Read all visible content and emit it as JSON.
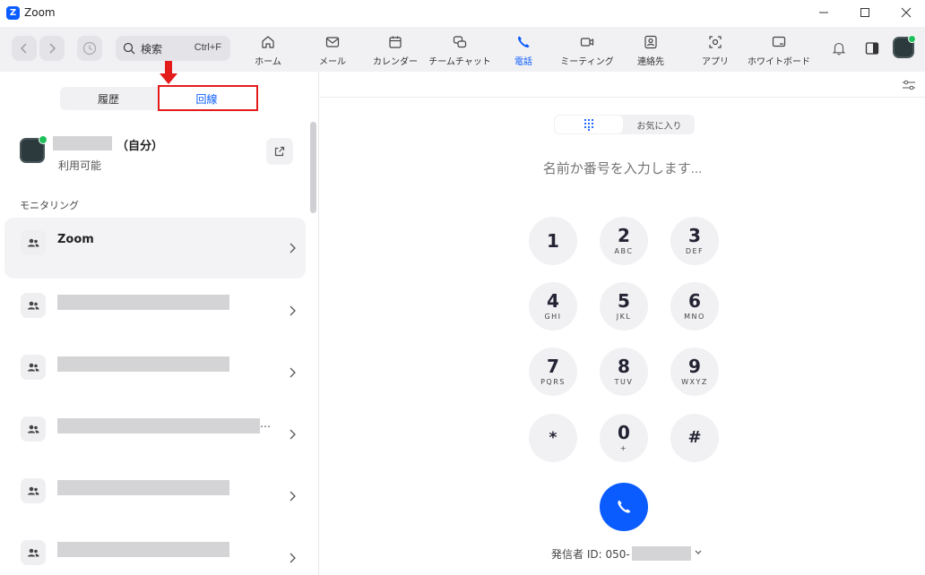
{
  "app": {
    "title": "Zoom",
    "logo_letter": "Z"
  },
  "search": {
    "label": "検索",
    "shortcut": "Ctrl+F"
  },
  "tabs": [
    {
      "label": "ホーム",
      "icon": "home-icon"
    },
    {
      "label": "メール",
      "icon": "mail-icon"
    },
    {
      "label": "カレンダー",
      "icon": "calendar-icon"
    },
    {
      "label": "チームチャット",
      "icon": "chat-icon"
    },
    {
      "label": "電話",
      "icon": "phone-icon",
      "active": true
    },
    {
      "label": "ミーティング",
      "icon": "video-icon"
    },
    {
      "label": "連絡先",
      "icon": "contacts-icon"
    },
    {
      "label": "アプリ",
      "icon": "apps-icon"
    },
    {
      "label": "ホワイトボード",
      "icon": "whiteboard-icon"
    }
  ],
  "left_panel": {
    "segment": {
      "history": "履歴",
      "lines": "回線"
    },
    "me": {
      "suffix": "（自分）",
      "status": "利用可能"
    },
    "section_title": "モニタリング",
    "lines": [
      {
        "name": "Zoom"
      }
    ]
  },
  "right_panel": {
    "favorites_tab": "お気に入り",
    "input_placeholder": "名前か番号を入力します...",
    "keys": [
      {
        "digit": "1",
        "letters": ""
      },
      {
        "digit": "2",
        "letters": "ABC"
      },
      {
        "digit": "3",
        "letters": "DEF"
      },
      {
        "digit": "4",
        "letters": "GHI"
      },
      {
        "digit": "5",
        "letters": "JKL"
      },
      {
        "digit": "6",
        "letters": "MNO"
      },
      {
        "digit": "7",
        "letters": "PQRS"
      },
      {
        "digit": "8",
        "letters": "TUV"
      },
      {
        "digit": "9",
        "letters": "WXYZ"
      },
      {
        "digit": "*",
        "letters": ""
      },
      {
        "digit": "0",
        "letters": "+"
      },
      {
        "digit": "#",
        "letters": ""
      }
    ],
    "caller_id_label": "発信者 ID: 050-"
  },
  "colors": {
    "accent": "#0b5cff",
    "presence": "#1ec05b",
    "annotation": "#e31b1b"
  }
}
